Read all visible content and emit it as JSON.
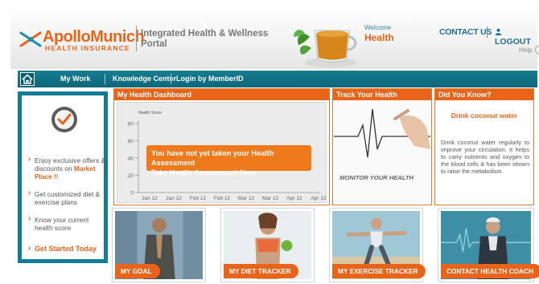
{
  "header": {
    "logo_word1": "Apollo",
    "logo_word2": "Munich",
    "logo_subtitle": "HEALTH INSURANCE",
    "portal_line1": "Integrated Health & Wellness",
    "portal_line2": "Portal",
    "welcome_label": "Welcome",
    "welcome_name": "Health",
    "contact_label": "CONTACT US",
    "logout_label": "LOGOUT",
    "help_label": "Help",
    "help_icon": "?"
  },
  "nav": {
    "items": [
      "My Work",
      "Knowledge Center",
      "Login by MemberID"
    ]
  },
  "left_panel": {
    "benefit1_text": "Enjoy exclusive offers & discounts on ",
    "benefit1_highlight": "Market Place !!",
    "benefit2": "Get customized diet & exercise plans",
    "benefit3": "Know your current health score",
    "get_started": "Get Started Today"
  },
  "dashboard": {
    "title": "My Health Dashboard",
    "overlay_line1": "You have not yet taken your Health Assessment",
    "overlay_line2": "Take Health Assessmont Now"
  },
  "chart_data": {
    "type": "line",
    "title": "Health Score",
    "xlabel": "",
    "ylabel": "",
    "categories": [
      "Jan 12",
      "Jan 12",
      "Feb 12",
      "Feb 12",
      "Mar 12",
      "Mar 12",
      "Apr 12",
      "Apr 12"
    ],
    "yticks": [
      0,
      20,
      40,
      60,
      80
    ],
    "ylim": [
      0,
      80
    ],
    "series": [],
    "grid": true
  },
  "track": {
    "title": "Track Your Health",
    "caption": "MONITOR YOUR HEALTH"
  },
  "know": {
    "title": "Did You Know?",
    "heading": "Drink coconut water",
    "body": "Drink coconut water regularly to improve your circulation. It helps to carry nutrients and oxygen to the blood cells & has been shown to raise the metabolism."
  },
  "tiles": {
    "goal": "MY GOAL",
    "diet": "MY DIET TRACKER",
    "exercise": "MY EXERCISE TRACKER",
    "coach": "CONTACT HEALTH COACH"
  },
  "colors": {
    "brand_orange": "#e8641b",
    "brand_teal": "#127d92"
  }
}
